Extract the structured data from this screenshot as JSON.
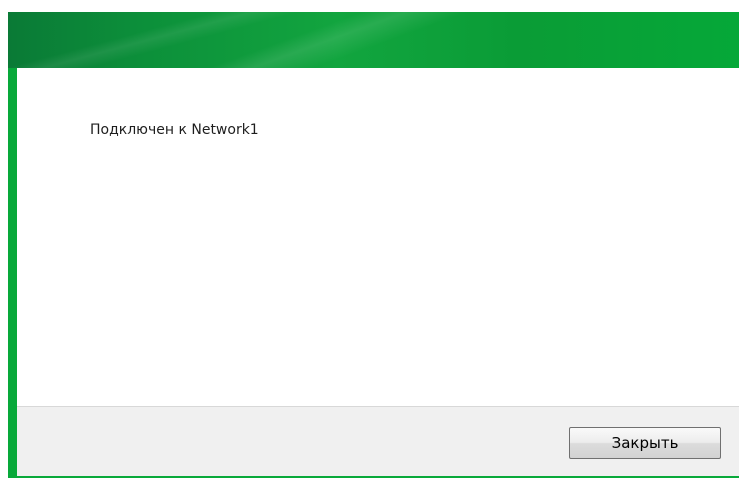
{
  "dialog": {
    "status_message": "Подключен к Network1",
    "close_label": "Закрыть"
  },
  "colors": {
    "frame": "#08a93a",
    "footer_bg": "#f0f0f0",
    "content_bg": "#ffffff"
  }
}
